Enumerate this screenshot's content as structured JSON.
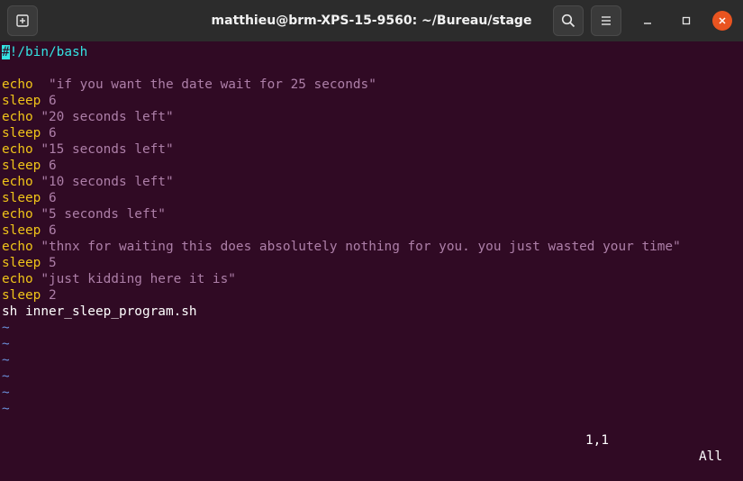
{
  "window": {
    "title": "matthieu@brm-XPS-15-9560: ~/Bureau/stage",
    "icons": {
      "new_tab": "new-tab-icon",
      "search": "search-icon",
      "menu": "hamburger-menu-icon",
      "minimize": "minimize-icon",
      "maximize": "maximize-icon",
      "close": "close-icon"
    },
    "colors": {
      "background": "#300a24",
      "keyword": "#f0c419",
      "string": "#ad7fa8",
      "shebang": "#34e2e2",
      "tilde": "#6a8fd8",
      "close_button": "#e95420"
    }
  },
  "editor": {
    "shebang_cursor_char": "#",
    "shebang_rest": "!/bin/bash",
    "code": [
      {
        "kw": "echo",
        "rest": "  \"if you want the date wait for 25 seconds\""
      },
      {
        "kw": "sleep",
        "rest": " 6"
      },
      {
        "kw": "echo",
        "rest": " \"20 seconds left\""
      },
      {
        "kw": "sleep",
        "rest": " 6"
      },
      {
        "kw": "echo",
        "rest": " \"15 seconds left\""
      },
      {
        "kw": "sleep",
        "rest": " 6"
      },
      {
        "kw": "echo",
        "rest": " \"10 seconds left\""
      },
      {
        "kw": "sleep",
        "rest": " 6"
      },
      {
        "kw": "echo",
        "rest": " \"5 seconds left\""
      },
      {
        "kw": "sleep",
        "rest": " 6"
      },
      {
        "kw": "echo",
        "rest": " \"thnx for waiting this does absolutely nothing for you. you just wasted your time\""
      },
      {
        "kw": "sleep",
        "rest": " 5"
      },
      {
        "kw": "echo",
        "rest": " \"just kidding here it is\""
      },
      {
        "kw": "sleep",
        "rest": " 2"
      }
    ],
    "last_command": "sh inner_sleep_program.sh",
    "tilde": "~",
    "status_position": "1,1",
    "status_scroll": "All"
  }
}
